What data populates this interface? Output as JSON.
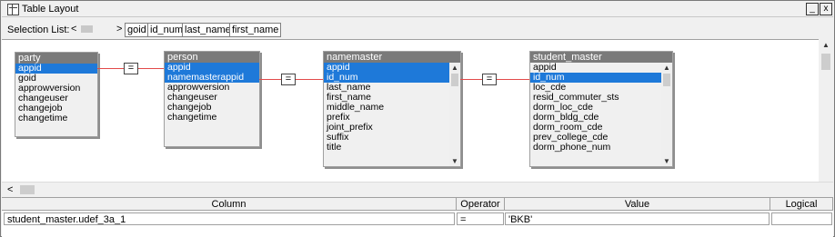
{
  "window": {
    "title": "Table Layout",
    "min_glyph": "_",
    "close_glyph": "x"
  },
  "selection": {
    "label": "Selection List:",
    "nav_left": "<",
    "nav_right": ">",
    "chips": [
      "goid",
      "id_num",
      "last_name",
      "first_name"
    ]
  },
  "join_operator": "=",
  "tables": [
    {
      "name": "party",
      "fields": [
        {
          "label": "appid",
          "selected": true
        },
        {
          "label": "goid",
          "selected": false
        },
        {
          "label": "approwversion",
          "selected": false
        },
        {
          "label": "changeuser",
          "selected": false
        },
        {
          "label": "changejob",
          "selected": false
        },
        {
          "label": "changetime",
          "selected": false
        }
      ]
    },
    {
      "name": "person",
      "fields": [
        {
          "label": "appid",
          "selected": true
        },
        {
          "label": "namemasterappid",
          "selected": true
        },
        {
          "label": "approwversion",
          "selected": false
        },
        {
          "label": "changeuser",
          "selected": false
        },
        {
          "label": "changejob",
          "selected": false
        },
        {
          "label": "changetime",
          "selected": false
        }
      ]
    },
    {
      "name": "namemaster",
      "fields": [
        {
          "label": "appid",
          "selected": true
        },
        {
          "label": "id_num",
          "selected": true
        },
        {
          "label": "last_name",
          "selected": false
        },
        {
          "label": "first_name",
          "selected": false
        },
        {
          "label": "middle_name",
          "selected": false
        },
        {
          "label": "prefix",
          "selected": false
        },
        {
          "label": "joint_prefix",
          "selected": false
        },
        {
          "label": "suffix",
          "selected": false
        },
        {
          "label": "title",
          "selected": false
        }
      ]
    },
    {
      "name": "student_master",
      "fields": [
        {
          "label": "appid",
          "selected": false
        },
        {
          "label": "id_num",
          "selected": true
        },
        {
          "label": "loc_cde",
          "selected": false
        },
        {
          "label": "resid_commuter_sts",
          "selected": false
        },
        {
          "label": "dorm_loc_cde",
          "selected": false
        },
        {
          "label": "dorm_bldg_cde",
          "selected": false
        },
        {
          "label": "dorm_room_cde",
          "selected": false
        },
        {
          "label": "prev_college_cde",
          "selected": false
        },
        {
          "label": "dorm_phone_num",
          "selected": false
        }
      ]
    }
  ],
  "criteria": {
    "headers": {
      "column": "Column",
      "operator": "Operator",
      "value": "Value",
      "logical": "Logical"
    },
    "rows": [
      {
        "column": "student_master.udef_3a_1",
        "operator": "=",
        "value": "'BKB'",
        "logical": ""
      }
    ]
  }
}
